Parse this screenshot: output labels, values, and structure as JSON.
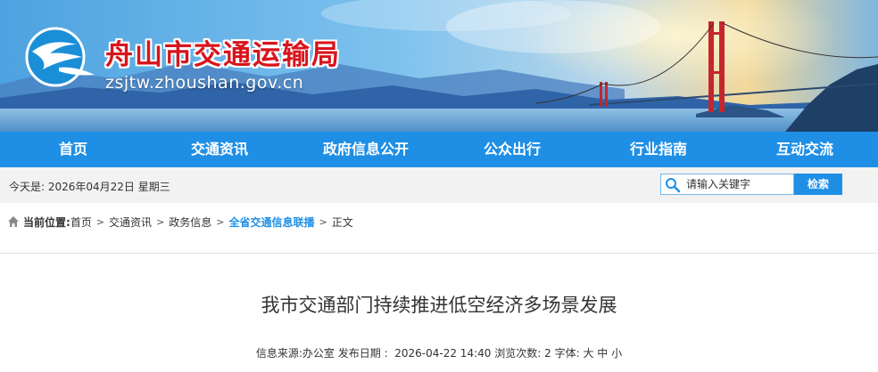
{
  "header": {
    "site_title": "舟山市交通运输局",
    "site_domain": "zsjtw.zhoushan.gov.cn"
  },
  "nav": {
    "items": [
      "首页",
      "交通资讯",
      "政府信息公开",
      "公众出行",
      "行业指南",
      "互动交流"
    ]
  },
  "infobar": {
    "today_label": "今天是: 2026年04月22日 星期三",
    "search_placeholder": "请输入关键字",
    "search_button": "检索"
  },
  "breadcrumb": {
    "label": "当前位置:",
    "items": [
      "首页",
      "交通资讯",
      "政务信息",
      "全省交通信息联播",
      "正文"
    ],
    "separator": ">"
  },
  "article": {
    "title": "我市交通部门持续推进低空经济多场景发展",
    "source_label": "信息来源:",
    "source_value": "办公室",
    "date_label": "发布日期 :",
    "date_value": "2026-04-22 14:40",
    "views_label": "浏览次数:",
    "views_value": "2",
    "font_label": "字体:",
    "font_large": "大",
    "font_medium": "中",
    "font_small": "小"
  },
  "colors": {
    "nav_bg": "#1f8fe6",
    "title_red": "#d8141c",
    "active_link": "#1f8fe6"
  },
  "icons": {
    "logo": "zhoushan-transport-logo",
    "search": "search-icon",
    "home": "home-icon"
  }
}
